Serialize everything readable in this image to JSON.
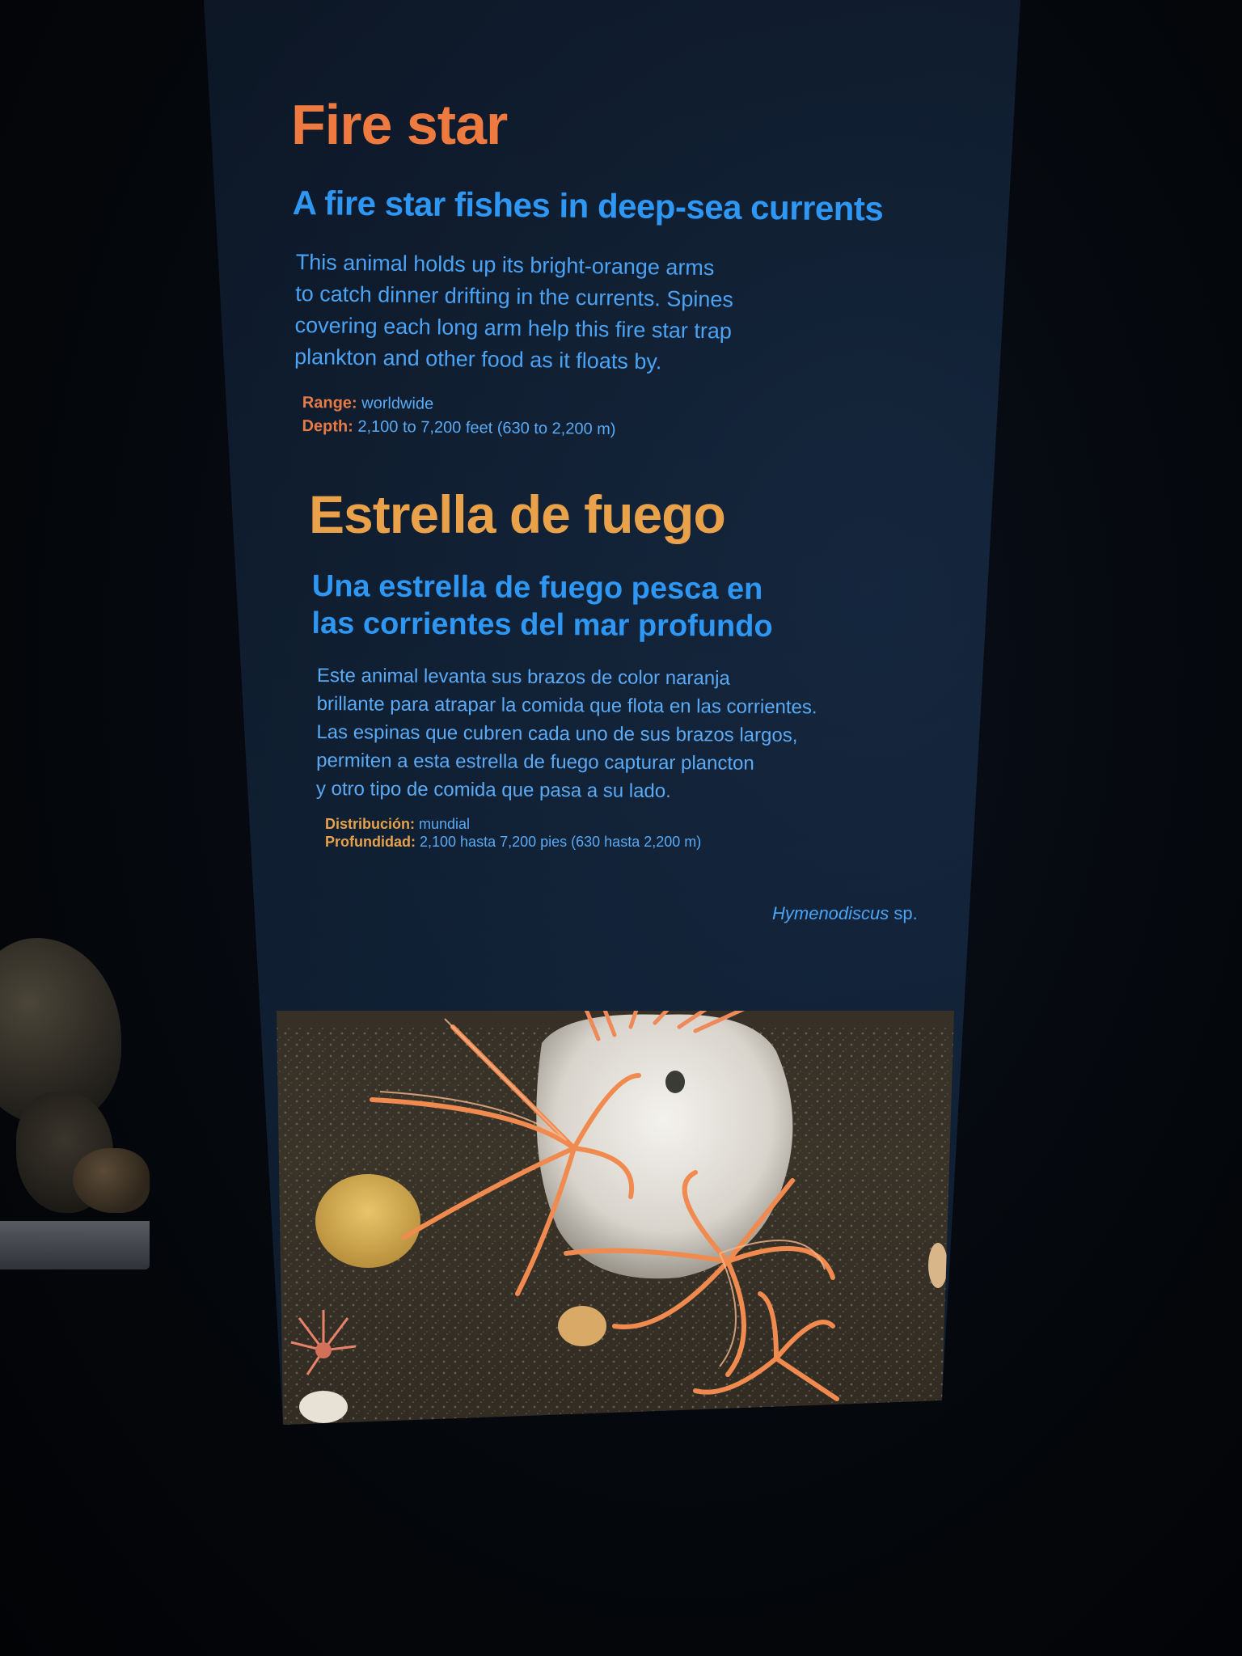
{
  "english": {
    "title": "Fire star",
    "subtitle": "A fire star fishes in deep-sea currents",
    "body_lines": [
      "This animal holds up its bright-orange arms",
      "to catch dinner drifting in the currents. Spines",
      "covering each long arm help this fire star trap",
      "plankton and other food as it floats by."
    ],
    "range_label": "Range:",
    "range_value": "worldwide",
    "depth_label": "Depth:",
    "depth_value": "2,100 to 7,200 feet (630 to 2,200 m)"
  },
  "spanish": {
    "title": "Estrella de fuego",
    "subtitle_lines": [
      "Una estrella de fuego pesca en",
      "las corrientes del mar profundo"
    ],
    "body_lines": [
      "Este animal levanta sus brazos de color naranja",
      "brillante para atrapar la comida que flota en las corrientes.",
      "Las espinas que cubren cada uno de sus brazos largos,",
      "permiten a esta estrella de fuego capturar plancton",
      "y otro tipo de comida que pasa a su lado."
    ],
    "range_label": "Distribución:",
    "range_value": "mundial",
    "depth_label": "Profundidad:",
    "depth_value": "2,100 hasta 7,200 pies (630 hasta 2,200 m)"
  },
  "scientific_name": {
    "genus": "Hymenodiscus",
    "suffix": "sp."
  },
  "colors": {
    "title_en": "#ef7a3f",
    "title_es": "#e9a24a",
    "text_blue": "#2e97f4",
    "panel_bg": "#0e1b2c"
  }
}
